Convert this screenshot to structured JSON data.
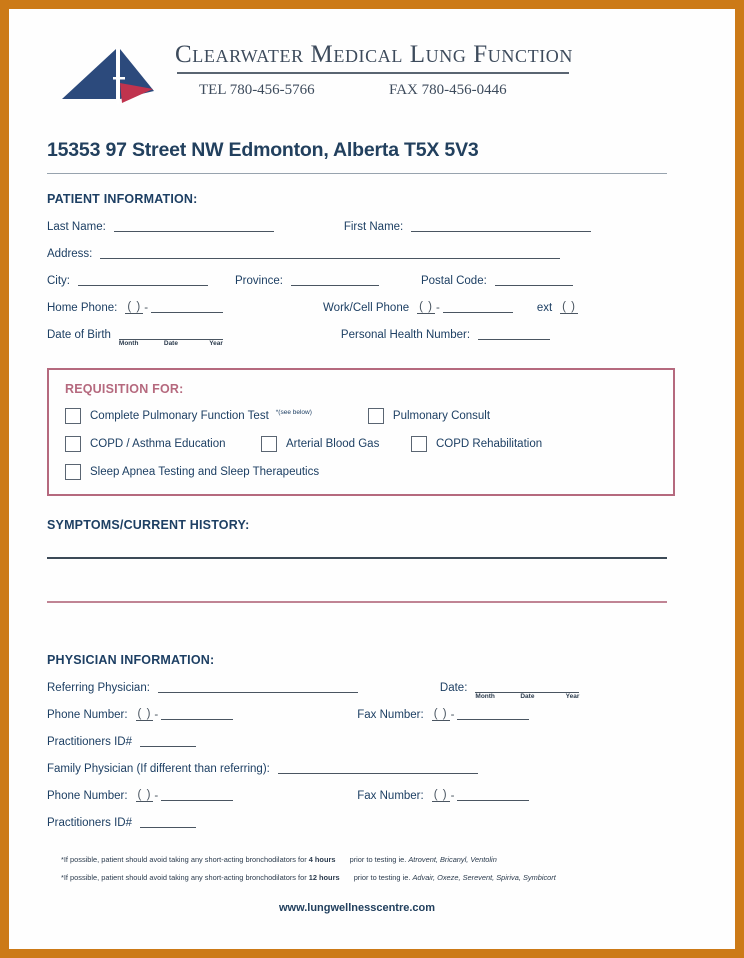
{
  "page": {
    "border_color": "#CC7A17",
    "accent_blue": "#1d3f63",
    "accent_rose": "#B5697E"
  },
  "header": {
    "logo_name": "sailboat-logo",
    "org_title": "Clearwater Medical Lung Function",
    "tel_label": "TEL",
    "tel_number": "780-456-5766",
    "fax_label": "FAX",
    "fax_number": "780-456-0446",
    "address": "15353 97 Street NW  Edmonton, Alberta T5X 5V3"
  },
  "patient": {
    "section_title": "PATIENT INFORMATION:",
    "last_name_label": "Last Name:",
    "last_name_value": "",
    "first_name_label": "First Name:",
    "first_name_value": "",
    "address_label": "Address:",
    "address_value": "",
    "city_label": "City:",
    "city_value": "",
    "province_label": "Province:",
    "province_value": "",
    "postal_code_label": "Postal Code:",
    "postal_code_value": "",
    "home_phone_label": "Home Phone:",
    "home_phone_area": "(   )",
    "home_phone_dash": "-",
    "home_phone_value": "",
    "work_phone_label": "Work/Cell Phone",
    "work_phone_area": "(   )",
    "work_phone_dash": "-",
    "work_phone_value": "",
    "ext_label": "ext",
    "ext_value": "(   )",
    "dob_label": "Date of Birth",
    "dob_value": "",
    "dob_month": "Month",
    "dob_date": "Date",
    "dob_year": "Year",
    "phn_label": "Personal Health Number:",
    "phn_value": ""
  },
  "requisition": {
    "title": "REQUISITION FOR:",
    "items": [
      {
        "label": "Complete Pulmonary Function Test",
        "note": "*(see below)",
        "checked": false
      },
      {
        "label": "Pulmonary Consult",
        "note": "",
        "checked": false
      },
      {
        "label": "COPD / Asthma Education",
        "note": "",
        "checked": false
      },
      {
        "label": "Arterial Blood Gas",
        "note": "",
        "checked": false
      },
      {
        "label": "COPD Rehabilitation",
        "note": "",
        "checked": false
      },
      {
        "label": "Sleep Apnea Testing and Sleep Therapeutics",
        "note": "",
        "checked": false
      }
    ]
  },
  "symptoms": {
    "section_title": "SYMPTOMS/CURRENT HISTORY:",
    "line1_value": "",
    "line2_value": ""
  },
  "physician": {
    "section_title": "PHYSICIAN INFORMATION:",
    "referring_label": "Referring Physician:",
    "referring_value": "",
    "date_label": "Date:",
    "date_value": "",
    "date_month": "Month",
    "date_date": "Date",
    "date_year": "Year",
    "phone_label": "Phone Number:",
    "phone_area": "(   )",
    "phone_dash": "-",
    "phone_value": "",
    "fax_label": "Fax Number:",
    "fax_area": "(   )",
    "fax_dash": "-",
    "fax_value": "",
    "practitioner_id_label": "Practitioners ID#",
    "practitioner_id_value": "",
    "family_label": "Family Physician (If different than referring):",
    "family_value": "",
    "family_phone_label": "Phone Number:",
    "family_phone_area": "(   )",
    "family_phone_dash": "-",
    "family_phone_value": "",
    "family_fax_label": "Fax Number:",
    "family_fax_area": "(   )",
    "family_fax_dash": "-",
    "family_fax_value": "",
    "family_practitioner_id_label": "Practitioners ID#",
    "family_practitioner_id_value": ""
  },
  "footnotes": [
    {
      "lead": "*If possible, patient should avoid taking any short-acting bronchodilators for",
      "hours": "4 hours",
      "tail": "prior to testing ie.",
      "drugs": "Atrovent, Bricanyl, Ventolin"
    },
    {
      "lead": "*If possible, patient should avoid taking any short-acting bronchodilators for",
      "hours": "12 hours",
      "tail": "prior to testing ie.",
      "drugs": "Advair, Oxeze, Serevent, Spiriva, Symbicort"
    }
  ],
  "footer": {
    "website": "www.lungwellnesscentre.com",
    "watermark": ""
  }
}
